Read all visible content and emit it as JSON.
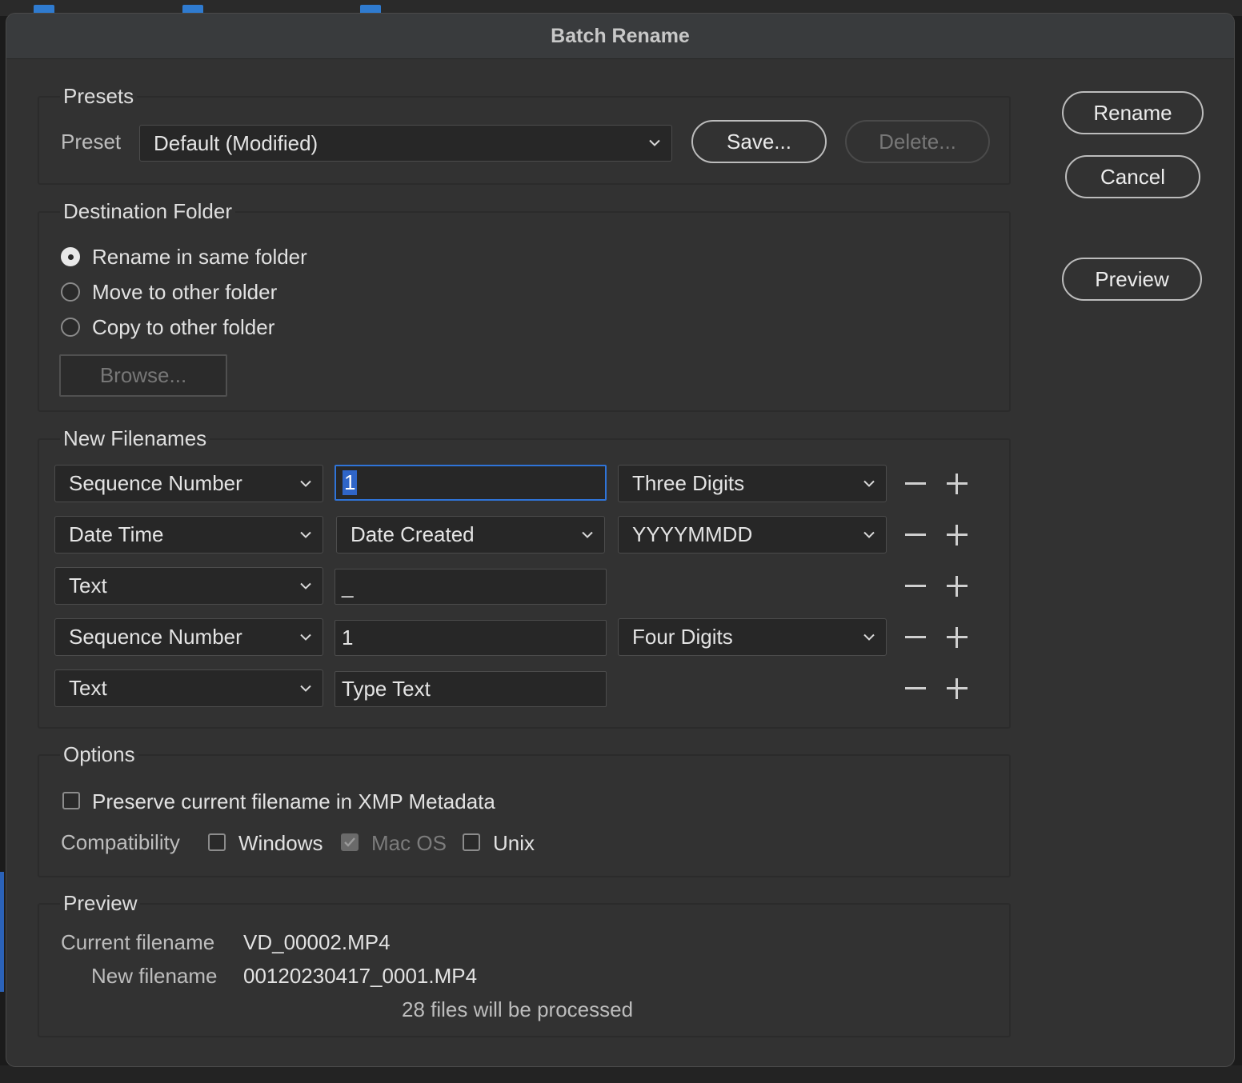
{
  "dialog": {
    "title": "Batch Rename",
    "buttons": {
      "rename": "Rename",
      "cancel": "Cancel",
      "preview": "Preview"
    }
  },
  "presets": {
    "title": "Presets",
    "preset_label": "Preset",
    "preset_value": "Default (Modified)",
    "save": "Save...",
    "delete": "Delete..."
  },
  "destination": {
    "title": "Destination Folder",
    "options": [
      "Rename in same folder",
      "Move to other folder",
      "Copy to other folder"
    ],
    "selected": "Rename in same folder",
    "browse": "Browse..."
  },
  "new_filenames": {
    "title": "New Filenames",
    "rows": [
      {
        "type": "Sequence Number",
        "value": "1",
        "format": "Three Digits"
      },
      {
        "type": "Date Time",
        "value": "Date Created",
        "format": "YYYYMMDD"
      },
      {
        "type": "Text",
        "value": "_",
        "format": ""
      },
      {
        "type": "Sequence Number",
        "value": "1",
        "format": "Four Digits"
      },
      {
        "type": "Text",
        "value": "",
        "placeholder": "Type Text",
        "format": ""
      }
    ]
  },
  "options": {
    "title": "Options",
    "preserve_label": "Preserve current filename in XMP Metadata",
    "preserve_checked": false,
    "compat_label": "Compatibility",
    "compat": [
      {
        "label": "Windows",
        "checked": false,
        "enabled": true
      },
      {
        "label": "Mac OS",
        "checked": true,
        "enabled": false
      },
      {
        "label": "Unix",
        "checked": false,
        "enabled": true
      }
    ]
  },
  "preview": {
    "title": "Preview",
    "current_label": "Current filename",
    "current_value": "VD_00002.MP4",
    "new_label": "New filename",
    "new_value": "00120230417_0001.MP4",
    "count_text": "28 files will be processed"
  },
  "colors": {
    "accent": "#2f74d8",
    "dialog_bg": "#323232",
    "field_bg": "#272727"
  },
  "icons": {
    "dropdown": "chevron-down-icon",
    "remove": "minus-icon",
    "add": "plus-icon"
  }
}
